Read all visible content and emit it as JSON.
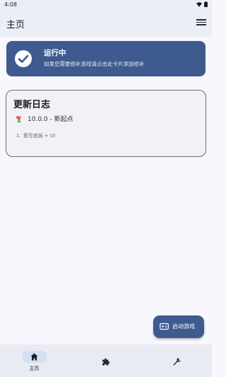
{
  "status_bar": {
    "time": "4:08"
  },
  "app_bar": {
    "title": "主页",
    "menu_icon": "hamburger-menu-icon"
  },
  "status_card": {
    "title": "运行中",
    "subtitle": "如果您需要修补游戏请点击此卡片添加修补",
    "icon": "check-circle-icon",
    "bg_color": "#3e5a8e"
  },
  "changelog": {
    "title": "更新日志",
    "version_icon": "bouquet-emoji-icon",
    "version": "10.0.0 - 新起点",
    "items": [
      {
        "num": "1.",
        "text": "重写底层 + UI"
      }
    ]
  },
  "fab": {
    "label": "启动游戏",
    "icon": "gamepad-icon"
  },
  "bottom_nav": {
    "items": [
      {
        "label": "主页",
        "icon": "home-icon",
        "selected": true
      },
      {
        "label": "",
        "icon": "puzzle-icon",
        "selected": false
      },
      {
        "label": "",
        "icon": "wrench-icon",
        "selected": false
      }
    ]
  },
  "colors": {
    "accent": "#3e5a8e",
    "background": "#f7f7fd",
    "bar": "#eceef6",
    "nav_pill": "#d5dff2"
  }
}
